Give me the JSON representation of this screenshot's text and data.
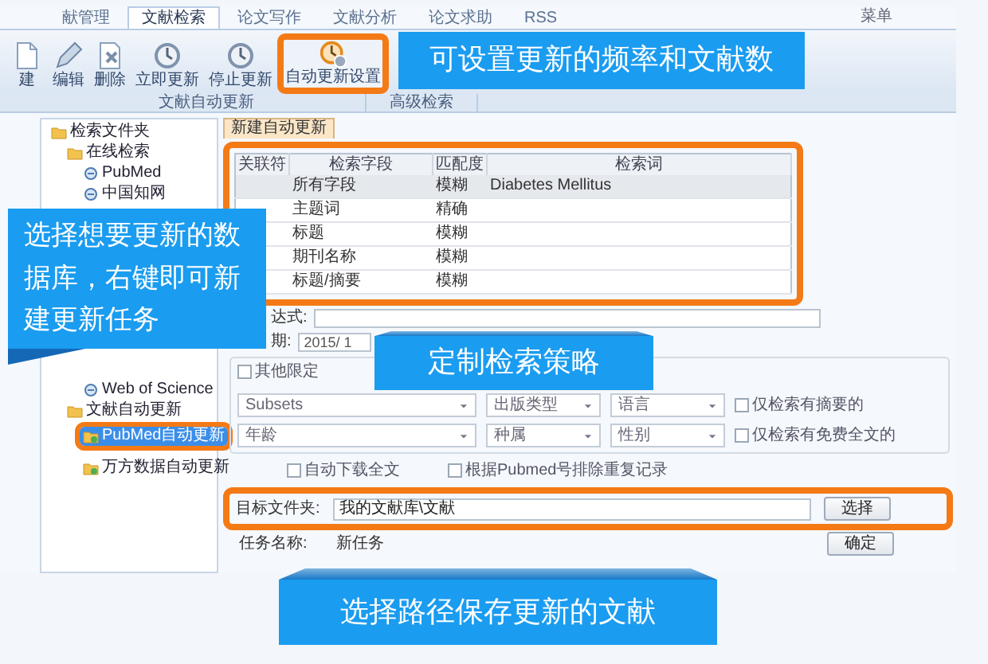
{
  "menu_tabs": [
    {
      "label": "献管理",
      "selected": false
    },
    {
      "label": "文献检索",
      "selected": true
    },
    {
      "label": "论文写作",
      "selected": false
    },
    {
      "label": "文献分析",
      "selected": false
    },
    {
      "label": "论文求助",
      "selected": false
    },
    {
      "label": "RSS",
      "selected": false
    }
  ],
  "menu_button": "菜单",
  "toolbar": {
    "buttons": [
      {
        "label": "建",
        "kind": "new",
        "highlighted": false
      },
      {
        "label": "编辑",
        "kind": "edit",
        "highlighted": false
      },
      {
        "label": "删除",
        "kind": "delete",
        "highlighted": false
      },
      {
        "label": "立即更新",
        "kind": "clock",
        "highlighted": false
      },
      {
        "label": "停止更新",
        "kind": "clock",
        "highlighted": false
      },
      {
        "label": "自动更新设置",
        "kind": "settings",
        "highlighted": true
      }
    ],
    "groups": [
      "文献自动更新",
      "高级检索"
    ]
  },
  "sidebar": {
    "tree": [
      {
        "label": "检索文件夹",
        "kind": "folder",
        "selected": false,
        "highlighted": false,
        "children": [
          {
            "label": "在线检索",
            "kind": "folder",
            "selected": false,
            "highlighted": false,
            "children": [
              {
                "label": "PubMed",
                "kind": "database",
                "selected": false,
                "highlighted": false
              },
              {
                "label": "中国知网",
                "kind": "database",
                "selected": false,
                "highlighted": false
              },
              {
                "label": "Web of Science",
                "kind": "database",
                "selected": false,
                "highlighted": false
              }
            ]
          },
          {
            "label": "文献自动更新",
            "kind": "folder",
            "selected": false,
            "highlighted": false,
            "children": [
              {
                "label": "PubMed自动更新",
                "kind": "task",
                "selected": true,
                "highlighted": true
              },
              {
                "label": "万方数据自动更新",
                "kind": "task",
                "selected": false,
                "highlighted": false
              }
            ]
          }
        ]
      }
    ]
  },
  "content_tab": "新建自动更新",
  "table": {
    "highlighted": true,
    "columns": [
      "关联符",
      "检索字段",
      "匹配度",
      "检索词"
    ],
    "rows": [
      {
        "cells": [
          "",
          "所有字段",
          "模糊",
          "Diabetes Mellitus"
        ],
        "selected": true
      },
      {
        "cells": [
          "",
          "主题词",
          "精确",
          ""
        ],
        "selected": false
      },
      {
        "cells": [
          "",
          "标题",
          "模糊",
          ""
        ],
        "selected": false
      },
      {
        "cells": [
          "",
          "期刊名称",
          "模糊",
          ""
        ],
        "selected": false
      },
      {
        "cells": [
          "",
          "标题/摘要",
          "模糊",
          ""
        ],
        "selected": false
      }
    ]
  },
  "expression": {
    "label": "达式:"
  },
  "date": {
    "label": "期:",
    "value": "2015/ 1"
  },
  "other_limits": {
    "label": "其他限定",
    "checked": false,
    "rows": [
      {
        "dropdowns": [
          "Subsets",
          "出版类型",
          "语言"
        ],
        "option": "仅检索有摘要的",
        "checked": false
      },
      {
        "dropdowns": [
          "年龄",
          "种属",
          "性别"
        ],
        "option": "仅检索有免费全文的",
        "checked": false
      }
    ]
  },
  "options": [
    {
      "label": "自动下载全文",
      "checked": false
    },
    {
      "label": "根据Pubmed号排除重复记录",
      "checked": false
    }
  ],
  "target_folder": {
    "label": "目标文件夹:",
    "value": "我的文献库\\文献",
    "button": "选择",
    "highlighted": true
  },
  "task": {
    "label": "任务名称:",
    "value": "新任务",
    "button": "确定"
  },
  "callouts": [
    {
      "text": "可设置更新的频率和文献数",
      "kind": "plain"
    },
    {
      "text": "选择想要更新的数据库，右键即可新建更新任务",
      "kind": "tail-bottom"
    },
    {
      "text": "定制检索策略",
      "kind": "tail-top"
    },
    {
      "text": "选择路径保存更新的文献",
      "kind": "tail-top"
    }
  ]
}
